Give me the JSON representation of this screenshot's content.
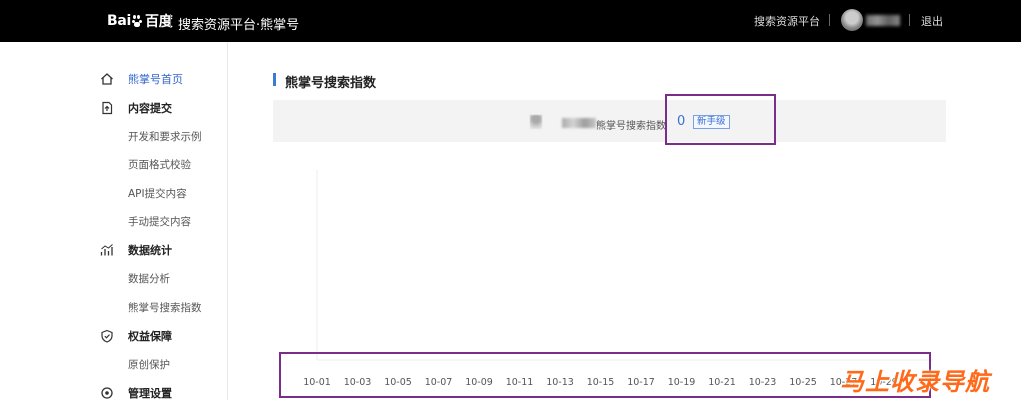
{
  "topbar": {
    "logo_text_left": "Bai",
    "logo_text_right": "百度",
    "title": "搜索资源平台·熊掌号",
    "platform_link": "搜索资源平台",
    "logout": "退出"
  },
  "sidebar": {
    "groups": [
      {
        "label": "熊掌号首页",
        "icon": "home-icon",
        "active": true
      },
      {
        "label": "内容提交",
        "icon": "upload-file-icon"
      },
      {
        "label": "数据统计",
        "icon": "chart-icon"
      },
      {
        "label": "权益保障",
        "icon": "shield-icon"
      },
      {
        "label": "管理设置",
        "icon": "settings-icon"
      }
    ],
    "content_submit_items": [
      "开发和要求示例",
      "页面格式校验",
      "API提交内容",
      "手动提交内容"
    ],
    "stats_items": [
      "数据分析",
      "熊掌号搜索指数"
    ],
    "rights_items": [
      "原创保护"
    ]
  },
  "main": {
    "title": "熊掌号搜索指数",
    "info_label": "熊掌号搜索指数",
    "index_value": "0",
    "level_badge": "新手级"
  },
  "chart_data": {
    "type": "line",
    "x": [
      "10-01",
      "10-03",
      "10-05",
      "10-07",
      "10-09",
      "10-11",
      "10-13",
      "10-15",
      "10-17",
      "10-19",
      "10-21",
      "10-23",
      "10-25",
      "10-27",
      "10-29"
    ],
    "series": []
  },
  "watermark": "马上收录导航",
  "colors": {
    "accent": "#3b6fd1",
    "highlight": "#7a2e8a",
    "topbar": "#000000"
  }
}
